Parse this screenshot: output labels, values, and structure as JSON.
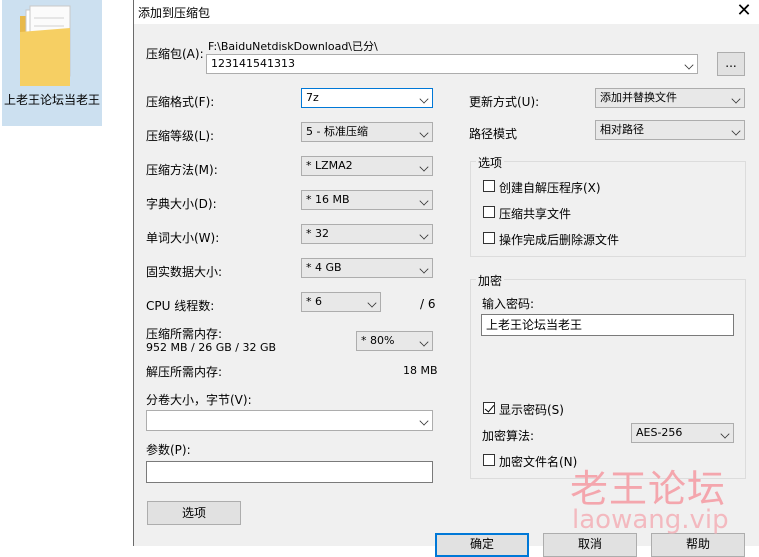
{
  "desktop": {
    "folder_label": "上老王论坛当老王"
  },
  "dialog": {
    "title": "添加到压缩包",
    "archive": {
      "label": "压缩包(A):",
      "path": "F:\\BaiduNetdiskDownload\\已分\\",
      "name": "123141541313",
      "browse_label": "..."
    },
    "left": {
      "format_label": "压缩格式(F):",
      "format_value": "7z",
      "level_label": "压缩等级(L):",
      "level_value": "5 - 标准压缩",
      "method_label": "压缩方法(M):",
      "method_value": "* LZMA2",
      "dict_label": "字典大小(D):",
      "dict_value": "* 16 MB",
      "word_label": "单词大小(W):",
      "word_value": "* 32",
      "solid_label": "固实数据大小:",
      "solid_value": "* 4 GB",
      "threads_label": "CPU 线程数:",
      "threads_value": "* 6",
      "threads_max": "/ 6",
      "mem_comp_label": "压缩所需内存:",
      "mem_comp_value": "952 MB / 26 GB / 32 GB",
      "mem_pct_value": "* 80%",
      "mem_decomp_label": "解压所需内存:",
      "mem_decomp_value": "18 MB",
      "split_label": "分卷大小，字节(V):",
      "split_value": "",
      "params_label": "参数(P):",
      "params_value": "",
      "options_button": "选项"
    },
    "right": {
      "update_label": "更新方式(U):",
      "update_value": "添加并替换文件",
      "pathmode_label": "路径模式",
      "pathmode_value": "相对路径",
      "options_group": "选项",
      "opt_sfx": "创建自解压程序(X)",
      "opt_shared": "压缩共享文件",
      "opt_delete": "操作完成后删除源文件",
      "encrypt_group": "加密",
      "password_label": "输入密码:",
      "password_value": "上老王论坛当老王",
      "show_password": "显示密码(S)",
      "algo_label": "加密算法:",
      "algo_value": "AES-256",
      "encrypt_names": "加密文件名(N)"
    },
    "buttons": {
      "ok": "确定",
      "cancel": "取消",
      "help": "帮助"
    },
    "checkboxes": {
      "sfx": false,
      "shared": false,
      "delete": false,
      "show_password": true,
      "encrypt_names": false
    }
  },
  "watermark": {
    "text": "老王论坛",
    "url": "laowang.vip"
  },
  "colors": {
    "accent": "#0078d7",
    "dialog_bg": "#f0f0f0",
    "watermark": "#f4a6ad"
  }
}
